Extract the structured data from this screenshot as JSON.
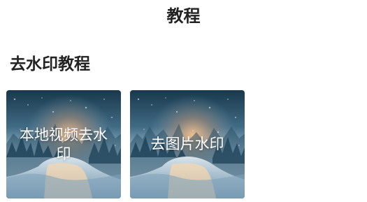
{
  "header": {
    "title": "教程"
  },
  "section": {
    "title": "去水印教程",
    "cards": [
      {
        "label": "本地视频去水印",
        "image": "snowy-forest-sunset-image"
      },
      {
        "label": "去图片水印",
        "image": "snowy-forest-sunset-image"
      }
    ]
  }
}
